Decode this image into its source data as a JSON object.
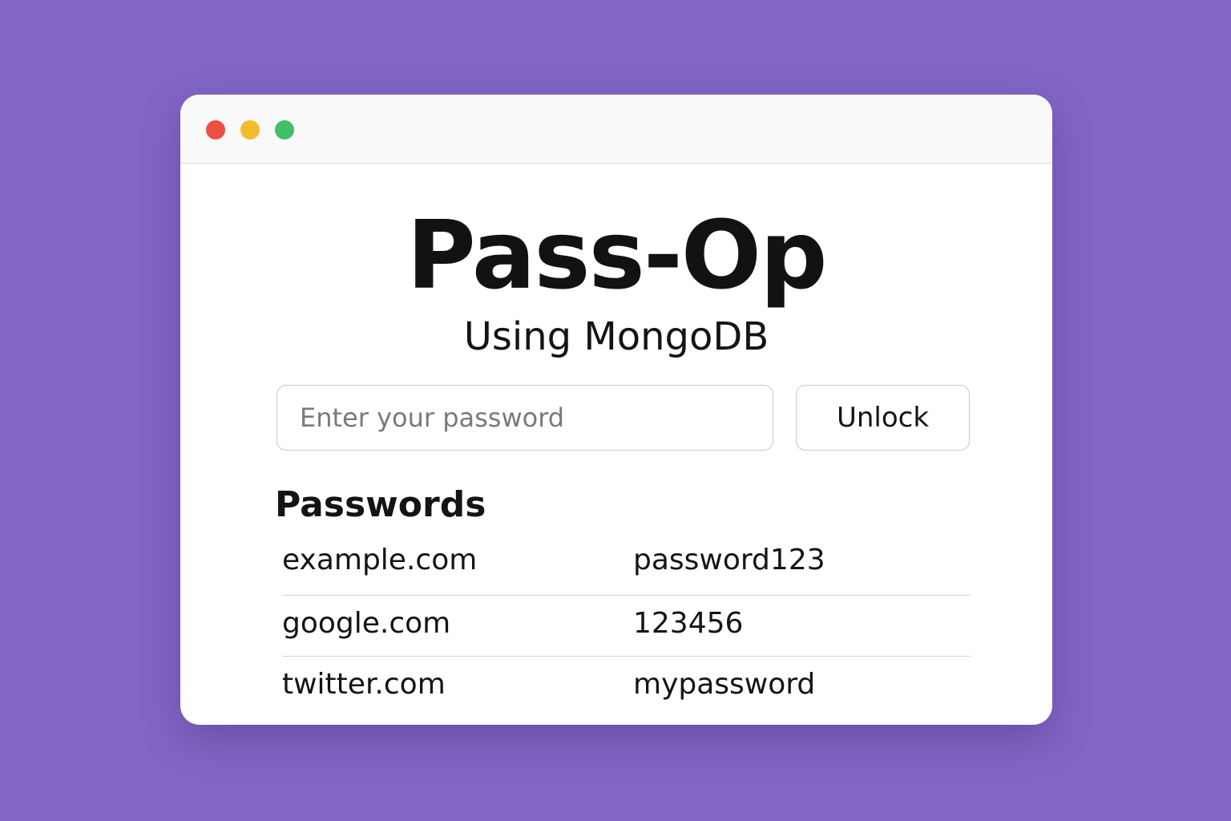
{
  "window": {
    "controls": [
      {
        "name": "close",
        "color": "#ee4f43"
      },
      {
        "name": "minimize",
        "color": "#f6bb2c"
      },
      {
        "name": "maximize",
        "color": "#3fc065"
      }
    ]
  },
  "header": {
    "title": "Pass-Op",
    "subtitle": "Using MongoDB"
  },
  "unlock_form": {
    "password_placeholder": "Enter your password",
    "password_value": "",
    "unlock_label": "Unlock"
  },
  "passwords": {
    "heading": "Passwords",
    "rows": [
      {
        "site": "example.com",
        "password": "password123"
      },
      {
        "site": "google.com",
        "password": "123456"
      },
      {
        "site": "twitter.com",
        "password": "mypassword"
      }
    ]
  },
  "colors": {
    "background": "#8266c5",
    "window": "#ffffff",
    "titlebar": "#f9f9fa",
    "text": "#141414"
  }
}
